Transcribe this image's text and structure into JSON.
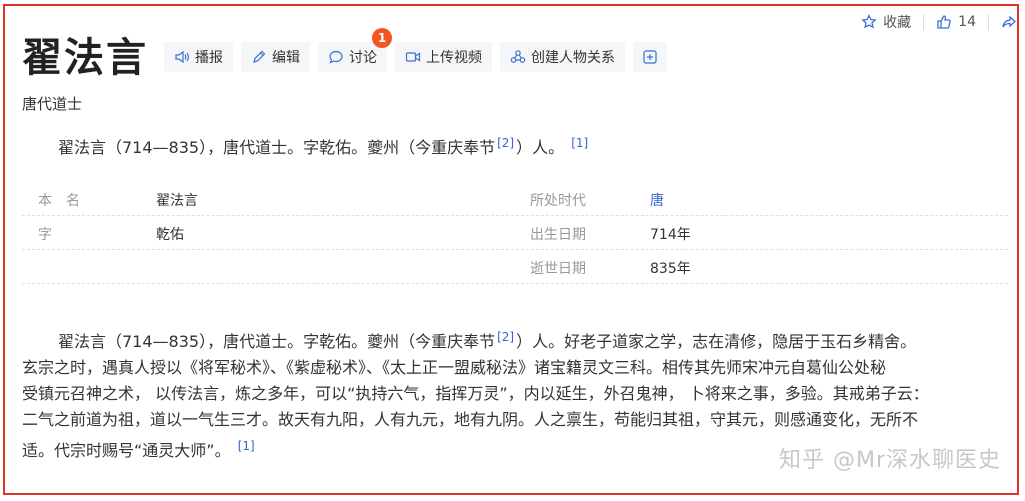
{
  "header": {
    "title": "翟法言",
    "subtitle": "唐代道士",
    "favorite_label": "收藏",
    "like_count": "14",
    "actions": [
      {
        "label": "播报",
        "icon": "speaker-icon"
      },
      {
        "label": "编辑",
        "icon": "pencil-icon"
      },
      {
        "label": "讨论",
        "icon": "chat-icon"
      },
      {
        "label": "上传视频",
        "icon": "video-icon"
      },
      {
        "label": "创建人物关系",
        "icon": "people-icon"
      }
    ],
    "discuss_badge": "1"
  },
  "summary": {
    "text_a": "翟法言（714—835），唐代道士。字乾佑。夔州（今重庆奉节",
    "ref_a": "[2]",
    "text_b": "）人。",
    "ref_b": "[1]"
  },
  "infobox": {
    "rows": [
      {
        "l1": "本　名",
        "v1": "翟法言",
        "l2": "所处时代",
        "v2": "唐"
      },
      {
        "l1": "字",
        "v1": "乾佑",
        "l2": "出生日期",
        "v2": "714年"
      },
      {
        "l1": "",
        "v1": "",
        "l2": "逝世日期",
        "v2": "835年"
      }
    ]
  },
  "paragraph": {
    "line1_a": "翟法言（714—835），唐代道士。字乾佑。夔州（今重庆奉节",
    "line1_ref": "[2]",
    "line1_b": "）人。好老子道家之学，志在清修，隐居于玉石乡精舍。",
    "line2": "玄宗之时，遇真人授以《将军秘术》、《紫虚秘术》、《太上正一盟威秘法》诸宝籍灵文三科。相传其先师宋冲元自葛仙公处秘",
    "line3": "受镇元召神之术， 以传法言，炼之多年，可以“执持六气，指挥万灵”，内以延生，外召鬼神， 卜将来之事，多验。其戒弟子云：",
    "line4": "二气之前道为祖，道以一气生三才。故天有九阳，人有九元，地有九阴。人之禀生，苟能归其祖，守其元，则感通变化，无所不",
    "line5": "适。代宗时赐号“通灵大师”。",
    "line5_ref": "[1]"
  },
  "watermark": "知乎 @Mr深水聊医史"
}
